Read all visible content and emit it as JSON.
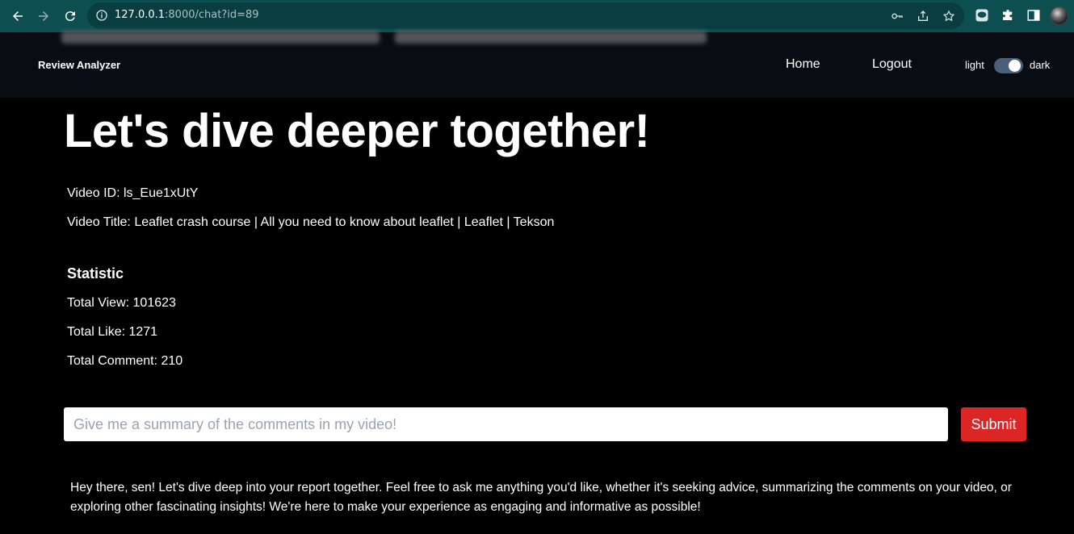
{
  "browser": {
    "url_host": "127.0.0.1",
    "url_path": ":8000/chat?id=89"
  },
  "navbar": {
    "brand": "Review Analyzer",
    "links": [
      {
        "label": "Home"
      },
      {
        "label": "Logout"
      }
    ],
    "theme_toggle": {
      "left_label": "light",
      "right_label": "dark",
      "state": "dark"
    }
  },
  "main": {
    "title": "Let's dive deeper together!",
    "video_id": "Video ID: ls_Eue1xUtY",
    "video_title": "Video Title: Leaflet crash course | All you need to know about leaflet | Leaflet | Tekson",
    "statistic": {
      "heading": "Statistic",
      "total_view": "Total View: 101623",
      "total_like": "Total Like: 1271",
      "total_comment": "Total Comment: 210"
    },
    "chat": {
      "placeholder": "Give me a summary of the comments in my video!",
      "value": "",
      "submit_label": "Submit"
    },
    "assistant_message": "Hey there, sen! Let's dive deep into your report together. Feel free to ask me anything you'd like, whether it's seeking advice, summarizing the comments on your video, or exploring other fascinating insights! We're here to make your experience as engaging and informative as possible!"
  },
  "colors": {
    "browser_bar": "#0d4f51",
    "navbar_bg": "#090c12",
    "page_bg": "#000000",
    "submit_bg": "#dc2626",
    "toggle_track": "#4b6078"
  }
}
